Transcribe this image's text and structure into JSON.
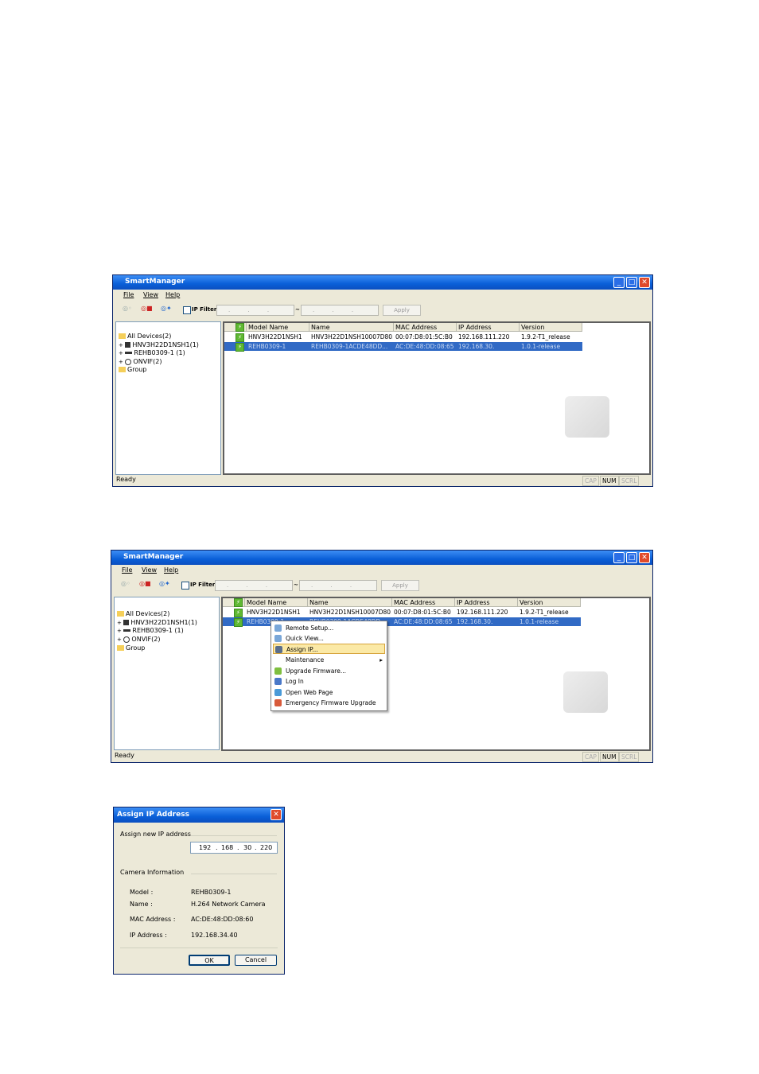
{
  "app": {
    "title": "SmartManager",
    "menu": [
      "File",
      "View",
      "Help"
    ],
    "toolbar": {
      "ip_filter_label": "IP Filter:",
      "ip_from_placeholder": ". . .",
      "ip_to_placeholder": ". . .",
      "separator": "~",
      "apply_label": "Apply"
    },
    "tree": [
      {
        "label": "All Devices(2)",
        "icon": "folder-icon"
      },
      {
        "label": "HNV3H22D1NSH1(1)",
        "icon": "camera-icon",
        "expander": "+"
      },
      {
        "label": "REHB0309-1 (1)",
        "icon": "encoder-icon",
        "expander": "+"
      },
      {
        "label": "ONVIF(2)",
        "icon": "onvif-icon",
        "expander": "+"
      },
      {
        "label": "Group",
        "icon": "folder-icon"
      }
    ],
    "columns": [
      "Model Name",
      "Name",
      "MAC Address",
      "IP Address",
      "Version"
    ],
    "rows": [
      {
        "model": "HNV3H22D1NSH1",
        "name": "HNV3H22D1NSH10007D80...",
        "mac": "00:07:D8:01:5C:B0",
        "ip": "192.168.111.220",
        "version": "1.9.2-T1_release"
      },
      {
        "model": "REHB0309-1",
        "name": "REHB0309-1ACDE48DD...",
        "mac": "AC:DE:48:DD:08:65",
        "ip": "192.168.30.",
        "version": "1.0.1-release"
      }
    ],
    "status": {
      "text": "Ready",
      "cap": "CAP",
      "num": "NUM",
      "scrl": "SCRL"
    }
  },
  "context_menu": {
    "items": [
      {
        "label": "Remote Setup...",
        "icon": "remote-setup-icon"
      },
      {
        "label": "Quick View...",
        "icon": "quick-view-icon"
      },
      {
        "label": "Assign IP...",
        "icon": "assign-ip-icon",
        "highlighted": true
      },
      {
        "label": "Maintenance",
        "icon": "",
        "submenu": true
      },
      {
        "label": "Upgrade Firmware...",
        "icon": "upgrade-icon"
      },
      {
        "label": "Log In",
        "icon": "login-icon"
      },
      {
        "label": "Open Web Page",
        "icon": "web-page-icon"
      },
      {
        "label": "Emergency Firmware Upgrade",
        "icon": "emergency-icon"
      }
    ],
    "submenu_arrow": "▸"
  },
  "dialog": {
    "title": "Assign IP Address",
    "section_ip": "Assign new IP address",
    "ip_octets": [
      "192",
      "168",
      "30",
      "220"
    ],
    "section_camera": "Camera Information",
    "fields": [
      {
        "label": "Model :",
        "value": "REHB0309-1"
      },
      {
        "label": "Name :",
        "value": "H.264 Network Camera"
      },
      {
        "label": "MAC Address :",
        "value": "AC:DE:48:DD:08:60"
      },
      {
        "label": "IP Address :",
        "value": "192.168.34.40"
      }
    ],
    "ok_label": "OK",
    "cancel_label": "Cancel"
  },
  "colors": {
    "title_blue": "#0a5fd8",
    "selection": "#316ac5",
    "window_bg": "#ece9d8",
    "close_red": "#e04a2a"
  }
}
